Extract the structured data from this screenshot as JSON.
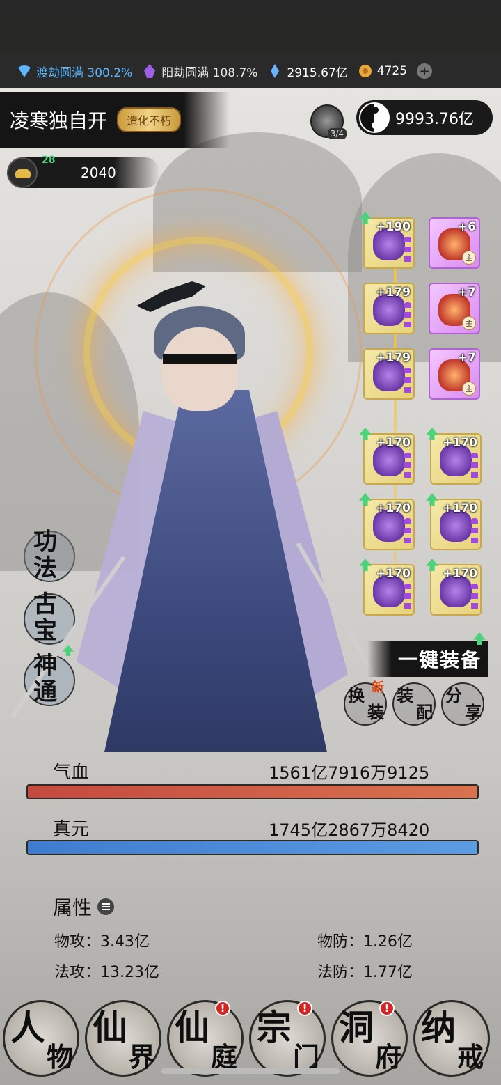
{
  "resources": {
    "realm1": "渡劫圆满 300.2%",
    "realm2": "阳劫圆满 108.7%",
    "spirit_stones": "2915.67亿",
    "gold": "4725"
  },
  "player": {
    "name": "凌寒独自开",
    "rank": "造化不朽",
    "level_up": "28",
    "level": "2040",
    "orb_count": "3/4",
    "power": "9993.76亿"
  },
  "equipment": {
    "right_col": [
      {
        "level": "+6",
        "tag": "主"
      },
      {
        "level": "+7",
        "tag": "主"
      },
      {
        "level": "+7",
        "tag": "主"
      }
    ],
    "left_col": [
      {
        "level": "+190"
      },
      {
        "level": "+179"
      },
      {
        "level": "+179"
      }
    ],
    "lower_left": [
      {
        "level": "+170"
      },
      {
        "level": "+170"
      },
      {
        "level": "+170"
      }
    ],
    "lower_right": [
      {
        "level": "+170"
      },
      {
        "level": "+170"
      },
      {
        "level": "+170"
      }
    ]
  },
  "side_buttons": {
    "gongfa": [
      "功",
      "法"
    ],
    "gubao": [
      "古",
      "宝"
    ],
    "shentong": [
      "神",
      "通"
    ]
  },
  "actions": {
    "one_key_equip": "一键装备",
    "change": [
      "换",
      "装"
    ],
    "new_tag": "新",
    "match": [
      "装",
      "配"
    ],
    "share": [
      "分",
      "享"
    ]
  },
  "stats": {
    "hp_label": "气血",
    "hp_value": "1561亿7916万9125",
    "mp_label": "真元",
    "mp_value": "1745亿2867万8420"
  },
  "attributes": {
    "title": "属性",
    "phys_atk": "物攻：3.43亿",
    "phys_def": "物防：1.26亿",
    "magic_atk": "法攻：13.23亿",
    "magic_def": "法防：1.77亿"
  },
  "nav": [
    {
      "g1": "人",
      "g2": "物",
      "alert": ""
    },
    {
      "g1": "仙",
      "g2": "界",
      "alert": ""
    },
    {
      "g1": "仙",
      "g2": "庭",
      "alert": "!"
    },
    {
      "g1": "宗",
      "g2": "门",
      "alert": "!"
    },
    {
      "g1": "洞",
      "g2": "府",
      "alert": "!"
    },
    {
      "g1": "纳",
      "g2": "戒",
      "alert": ""
    }
  ]
}
